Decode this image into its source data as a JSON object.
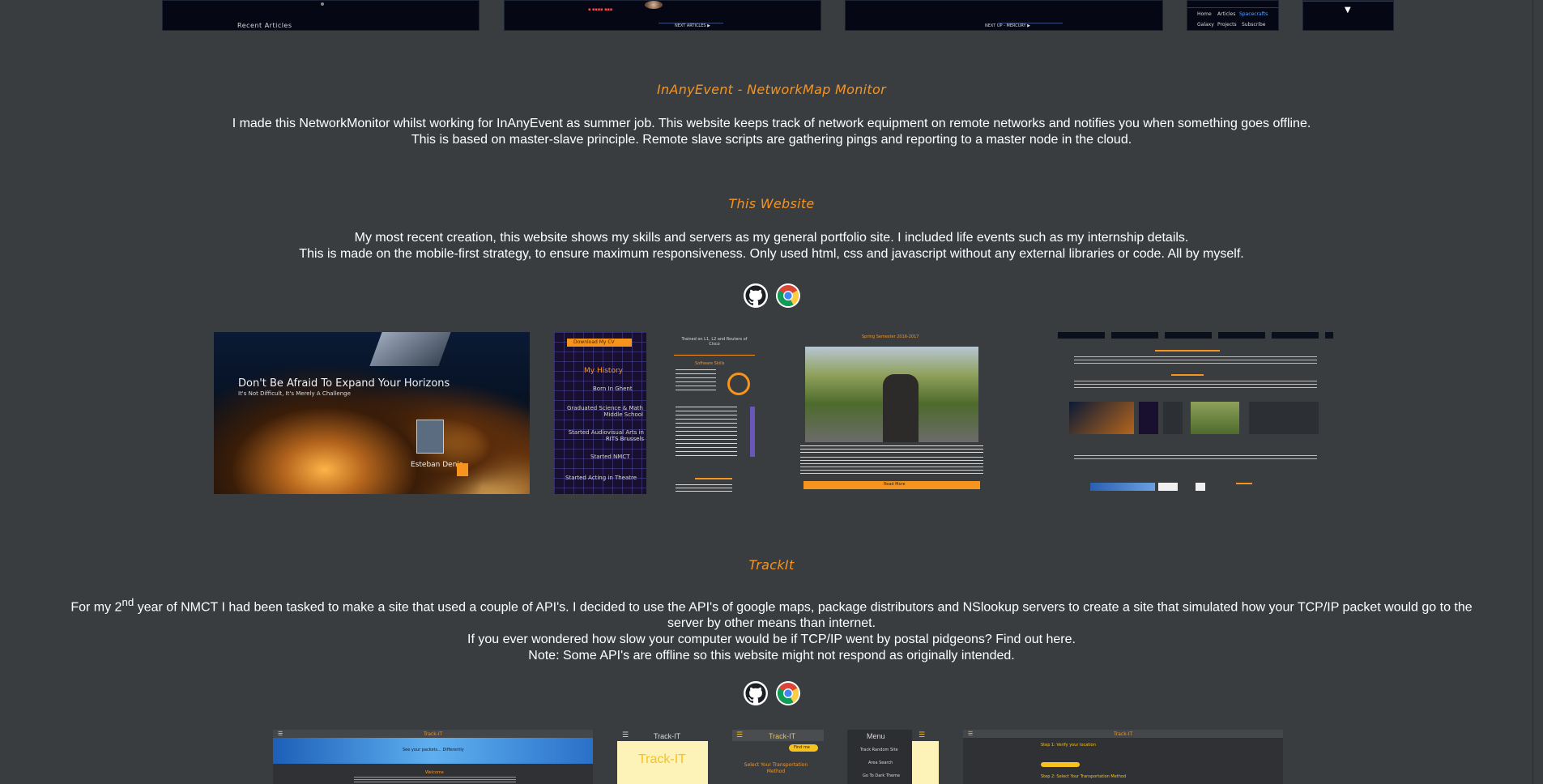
{
  "colors": {
    "background": "#3a3d40",
    "accent": "#f7941e",
    "text": "#ffffff"
  },
  "top_strip": {
    "recent_articles": "Recent Articles",
    "next_articles": "NEXT ARTICLES ▶",
    "next_up": "NEXT UP - MERCURY ▶",
    "nav_home": "Home",
    "nav_articles": "Articles",
    "nav_spacecrafts": "Spacecrafts",
    "nav_galaxy": "Galaxy",
    "nav_projects": "Projects",
    "nav_subscribe": "Subscribe",
    "dropdown_arrow": "▼"
  },
  "projects": [
    {
      "title": "InAnyEvent - NetworkMap Monitor",
      "lines": [
        "I made this NetworkMonitor whilst working for InAnyEvent as summer job. This website keeps track of network equipment on remote networks and notifies you when something goes offline.",
        "This is based on master-slave principle. Remote slave scripts are gathering pings and reporting to a master node in the cloud."
      ]
    },
    {
      "title": "This Website",
      "lines": [
        "My most recent creation, this website shows my skills and servers as my general portfolio site. I included life events such as my internship details.",
        "This is made on the mobile-first strategy, to ensure maximum responsiveness. Only used html, css and javascript without any external libraries or code. All by myself."
      ],
      "links": {
        "github": "github-icon",
        "website": "chrome-icon"
      },
      "gallery": {
        "hero_title": "Don't Be Afraid To Expand Your Horizons",
        "hero_subtitle": "It's Not Difficult, It's Merely A Challenge",
        "hero_name": "Esteban Denis",
        "history_title": "My History",
        "history_button": "Download My CV",
        "history_items": [
          "Born In Ghent",
          "Graduated Science & Math Middle School",
          "Started Audiovisual Arts in RITS Brussels",
          "Started NMCT",
          "Started Acting in Theatre"
        ],
        "skills_heading": "Trained on L1, L2 and Routers of Cisco",
        "software_skills": "Software Skills",
        "trip_title": "Spring Semester 2016-2017",
        "trip_button": "Read More"
      }
    },
    {
      "title": "TrackIt",
      "lines_html": [
        "For my 2<sup>nd</sup> year of NMCT I had been tasked to make a site that used a couple of API's. I decided to use the API's of google maps, package distributors and NSlookup servers to create a site that simulated how your TCP/IP packet would go to the",
        "server by other means than internet.",
        "If you ever wondered how slow your computer would be if TCP/IP went by postal pidgeons? Find out here.",
        "Note: Some API's are offline so this website might not respond as originally intended."
      ],
      "links": {
        "github": "github-icon",
        "website": "chrome-icon"
      },
      "gallery": {
        "app_name": "Track-IT",
        "tagline": "See your packets... Differently",
        "welcome": "Welcome",
        "mobile_logo": "Track-IT",
        "transport_prompt": "Select Your Transportation Method",
        "find_button": "Find me",
        "menu_title": "Menu",
        "menu_items": [
          "Track Random Site",
          "Area Search",
          "Go To Dark Theme"
        ],
        "step1": "Step 1: Verify your location",
        "step2": "Step 2: Select Your Transportation Method"
      }
    }
  ]
}
